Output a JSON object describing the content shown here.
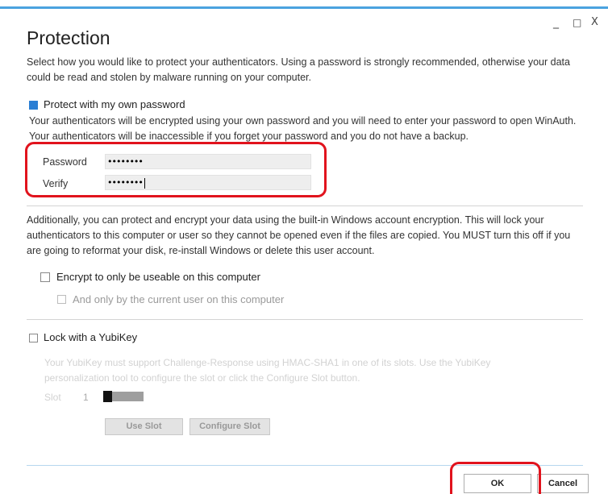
{
  "window": {
    "controls": {
      "minimize": "_",
      "maximize": "□",
      "close": "X"
    }
  },
  "protection": {
    "title": "Protection",
    "description": "Select how you would like to protect your authenticators. Using a password is strongly recommended, otherwise your data could be read and stolen by malware running on your computer."
  },
  "password_section": {
    "checkbox_label": "Protect with my own password",
    "checked": true,
    "note": "Your authenticators will be encrypted using your own password and you will need to enter your password to open WinAuth. Your authenticators will be inaccessible if you forget your password and you do not have a backup.",
    "password_label": "Password",
    "password_value": "••••••••",
    "verify_label": "Verify",
    "verify_value": "••••••••"
  },
  "windows_encryption": {
    "description": "Additionally, you can protect and encrypt your data using the built-in Windows account encryption. This will lock your authenticators to this computer or user so they cannot be opened even if the files are copied. You MUST turn this off if you are going to reformat your disk, re-install Windows or delete this user account.",
    "computer_label": "Encrypt to only be useable on this computer",
    "computer_checked": false,
    "user_label": "And only by the current user on this computer",
    "user_checked": false
  },
  "yubikey": {
    "checkbox_label": "Lock with a YubiKey",
    "checked": false,
    "note": "Your YubiKey must support Challenge-Response using HMAC-SHA1 in one of its slots. Use the YubiKey personalization tool to configure the slot or click the Configure Slot button.",
    "slot_label": "Slot",
    "slot_value": "1",
    "use_slot_button": "Use Slot",
    "configure_slot_button": "Configure Slot"
  },
  "footer": {
    "ok_button": "OK",
    "cancel_button": "Cancel"
  },
  "colors": {
    "accent": "#2b7fd4",
    "highlight": "#e1131d",
    "topbar": "#4aa3df"
  }
}
